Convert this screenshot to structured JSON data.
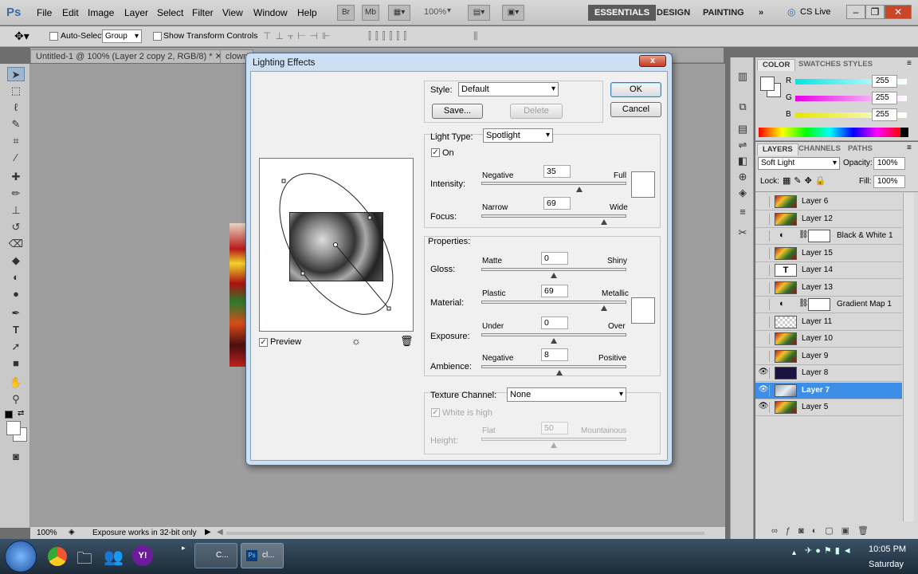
{
  "app": {
    "logo": "Ps",
    "menu": [
      "File",
      "Edit",
      "Image",
      "Layer",
      "Select",
      "Filter",
      "View",
      "Window",
      "Help"
    ],
    "bridge_btn": "Br",
    "minibridge_btn": "Mb",
    "zoom": "100%",
    "workspaces": [
      "ESSENTIALS",
      "DESIGN",
      "PAINTING"
    ],
    "more_workspaces": "»",
    "cs_live": "CS Live"
  },
  "options": {
    "auto_select_label": "Auto-Select:",
    "auto_select_value": "Group",
    "transform_label": "Show Transform Controls"
  },
  "doc_tabs": [
    "Untitled-1 @ 100% (Layer 2 copy 2, RGB/8) *",
    "clown"
  ],
  "status": {
    "zoom": "100%",
    "message": "Exposure works in 32-bit only"
  },
  "color_panel": {
    "tabs": [
      "COLOR",
      "SWATCHES",
      "STYLES"
    ],
    "channels": [
      {
        "label": "R",
        "value": "255",
        "color": "#00e6e6"
      },
      {
        "label": "G",
        "value": "255",
        "color": "#e600e6"
      },
      {
        "label": "B",
        "value": "255",
        "color": "#e6e600"
      }
    ]
  },
  "layers_panel": {
    "tabs": [
      "LAYERS",
      "CHANNELS",
      "PATHS"
    ],
    "blend_mode": "Soft Light",
    "opacity_label": "Opacity:",
    "opacity": "100%",
    "lock_label": "Lock:",
    "fill_label": "Fill:",
    "fill": "100%",
    "layers": [
      {
        "name": "Layer 6",
        "visible": false,
        "type": "image"
      },
      {
        "name": "Layer 12",
        "visible": false,
        "type": "image"
      },
      {
        "name": "Black & White 1",
        "visible": false,
        "type": "adjustment"
      },
      {
        "name": "Layer 15",
        "visible": false,
        "type": "image"
      },
      {
        "name": "Layer 14",
        "visible": false,
        "type": "text"
      },
      {
        "name": "Layer 13",
        "visible": false,
        "type": "image"
      },
      {
        "name": "Gradient Map 1",
        "visible": false,
        "type": "adjustment"
      },
      {
        "name": "Layer 11",
        "visible": false,
        "type": "transparent"
      },
      {
        "name": "Layer 10",
        "visible": false,
        "type": "image"
      },
      {
        "name": "Layer 9",
        "visible": false,
        "type": "image"
      },
      {
        "name": "Layer 8",
        "visible": true,
        "type": "dark"
      },
      {
        "name": "Layer 7",
        "visible": true,
        "type": "selected",
        "selected": true
      },
      {
        "name": "Layer 5",
        "visible": true,
        "type": "image"
      }
    ]
  },
  "dialog": {
    "title": "Lighting Effects",
    "close": "x",
    "ok": "OK",
    "cancel": "Cancel",
    "style_label": "Style:",
    "style_value": "Default",
    "save": "Save...",
    "delete": "Delete",
    "light_type_label": "Light Type:",
    "light_type_value": "Spotlight",
    "on_label": "On",
    "intensity": {
      "label": "Intensity:",
      "left": "Negative",
      "right": "Full",
      "value": "35"
    },
    "focus": {
      "label": "Focus:",
      "left": "Narrow",
      "right": "Wide",
      "value": "69"
    },
    "properties_label": "Properties:",
    "gloss": {
      "label": "Gloss:",
      "left": "Matte",
      "right": "Shiny",
      "value": "0"
    },
    "material": {
      "label": "Material:",
      "left": "Plastic",
      "right": "Metallic",
      "value": "69"
    },
    "exposure": {
      "label": "Exposure:",
      "left": "Under",
      "right": "Over",
      "value": "0"
    },
    "ambience": {
      "label": "Ambience:",
      "left": "Negative",
      "right": "Positive",
      "value": "8"
    },
    "texture_label": "Texture Channel:",
    "texture_value": "None",
    "white_is_high": "White is high",
    "height": {
      "label": "Height:",
      "left": "Flat",
      "right": "Mountainous",
      "value": "50"
    },
    "preview_label": "Preview"
  },
  "taskbar": {
    "items": [
      "C...",
      "cl..."
    ],
    "time": "10:05 PM",
    "day": "Saturday"
  }
}
